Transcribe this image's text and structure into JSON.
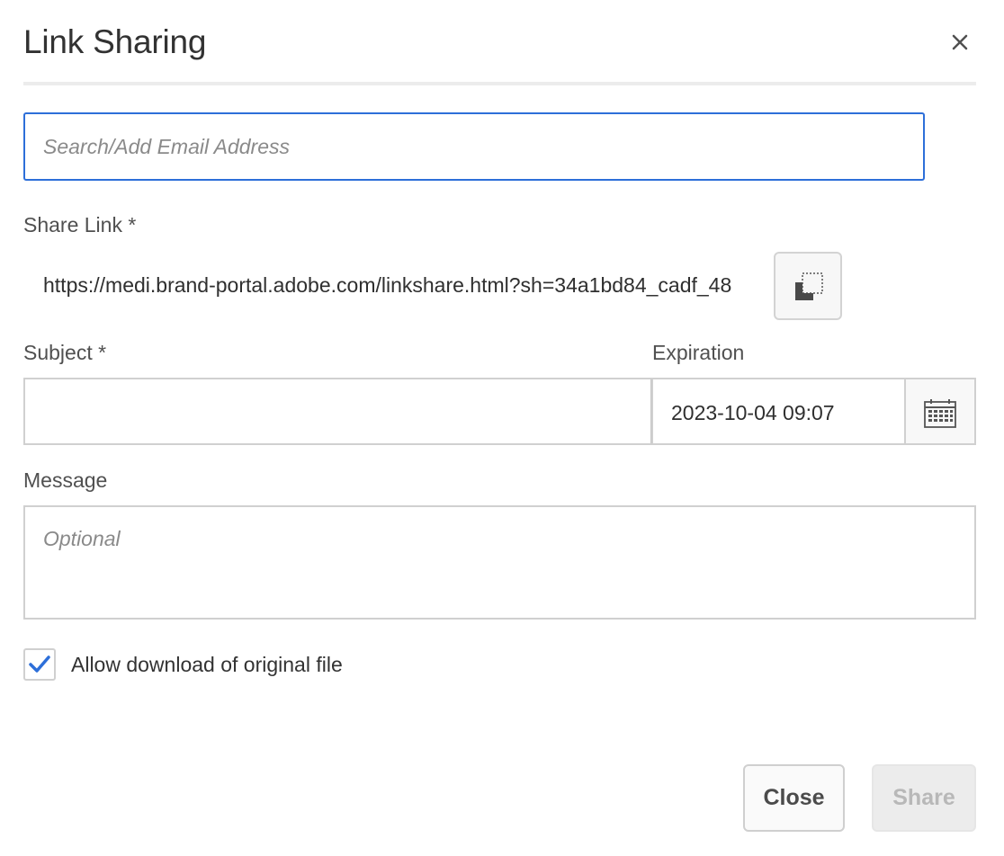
{
  "dialog": {
    "title": "Link Sharing"
  },
  "email": {
    "placeholder": "Search/Add Email Address",
    "value": ""
  },
  "share_link": {
    "label": "Share Link *",
    "value": "https://medi.brand-portal.adobe.com/linkshare.html?sh=34a1bd84_cadf_48",
    "copy_icon": "copy-icon"
  },
  "subject": {
    "label": "Subject *",
    "value": ""
  },
  "expiration": {
    "label": "Expiration",
    "value": "2023-10-04 09:07",
    "calendar_icon": "calendar-icon"
  },
  "message": {
    "label": "Message",
    "placeholder": "Optional"
  },
  "allow_download": {
    "label": "Allow download of original file",
    "checked": true
  },
  "footer": {
    "close_label": "Close",
    "share_label": "Share"
  },
  "colors": {
    "accent": "#2d6fd9",
    "checkmark": "#2d6fd9",
    "disabled_text": "#b8b8b8"
  }
}
